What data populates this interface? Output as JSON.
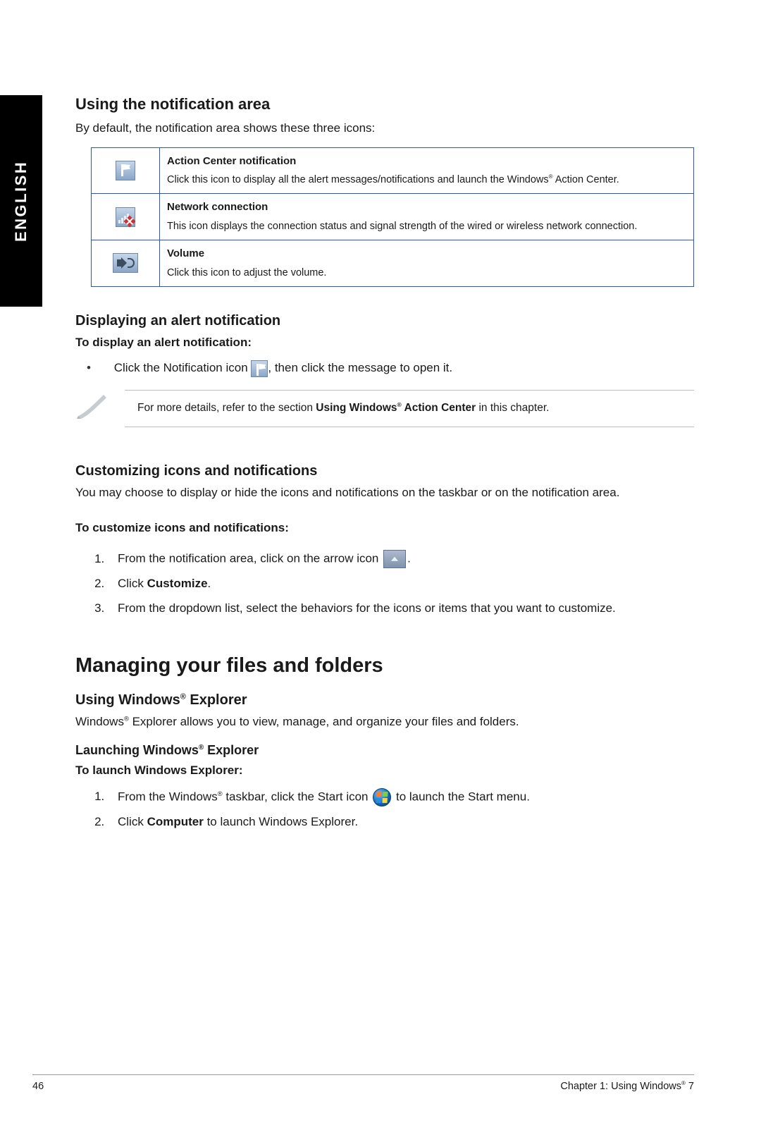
{
  "language_tab": "ENGLISH",
  "sec1": {
    "heading": "Using the notification area",
    "intro": "By default, the notification area shows these three icons:",
    "rows": [
      {
        "title": "Action Center notification",
        "desc_pre": "Click this icon to display all the alert messages/notifications and launch the Windows",
        "desc_post": " Action Center."
      },
      {
        "title": "Network connection",
        "desc": "This icon displays the connection status and signal strength of the wired or wireless network connection."
      },
      {
        "title": "Volume",
        "desc": "Click this icon to adjust the volume."
      }
    ]
  },
  "sec2": {
    "heading": "Displaying an alert notification",
    "sub": "To display an alert notification:",
    "bullet_pre": "Click the Notification icon ",
    "bullet_post": ", then click the message to open it.",
    "note_pre": "For more details, refer to the section ",
    "note_ref_a": "Using Windows",
    "note_ref_b": " Action Center",
    "note_post": " in this chapter."
  },
  "sec3": {
    "heading": "Customizing icons and notifications",
    "intro": "You may choose to display or hide the icons and notifications on the taskbar or on the notification area.",
    "sub": "To customize icons and notifications:",
    "li1_pre": "From the notification area, click on the arrow icon ",
    "li1_post": ".",
    "li2_pre": "Click ",
    "li2_bold": "Customize",
    "li2_post": ".",
    "li3": "From the dropdown list, select the behaviors for the icons or items that you want to customize."
  },
  "sec4": {
    "heading": "Managing your files and folders",
    "sub1_a": "Using Windows",
    "sub1_b": " Explorer",
    "intro_a": "Windows",
    "intro_b": " Explorer allows you to view, manage, and organize your files and folders.",
    "sub2_a": "Launching Windows",
    "sub2_b": " Explorer",
    "sub3": "To launch Windows Explorer:",
    "li1_pre": "From the Windows",
    "li1_mid": " taskbar, click the Start icon ",
    "li1_post": " to launch the Start menu.",
    "li2_pre": "Click ",
    "li2_bold": "Computer",
    "li2_post": " to launch Windows Explorer."
  },
  "footer": {
    "page": "46",
    "chapter_a": "Chapter 1: Using Windows",
    "chapter_b": " 7"
  }
}
